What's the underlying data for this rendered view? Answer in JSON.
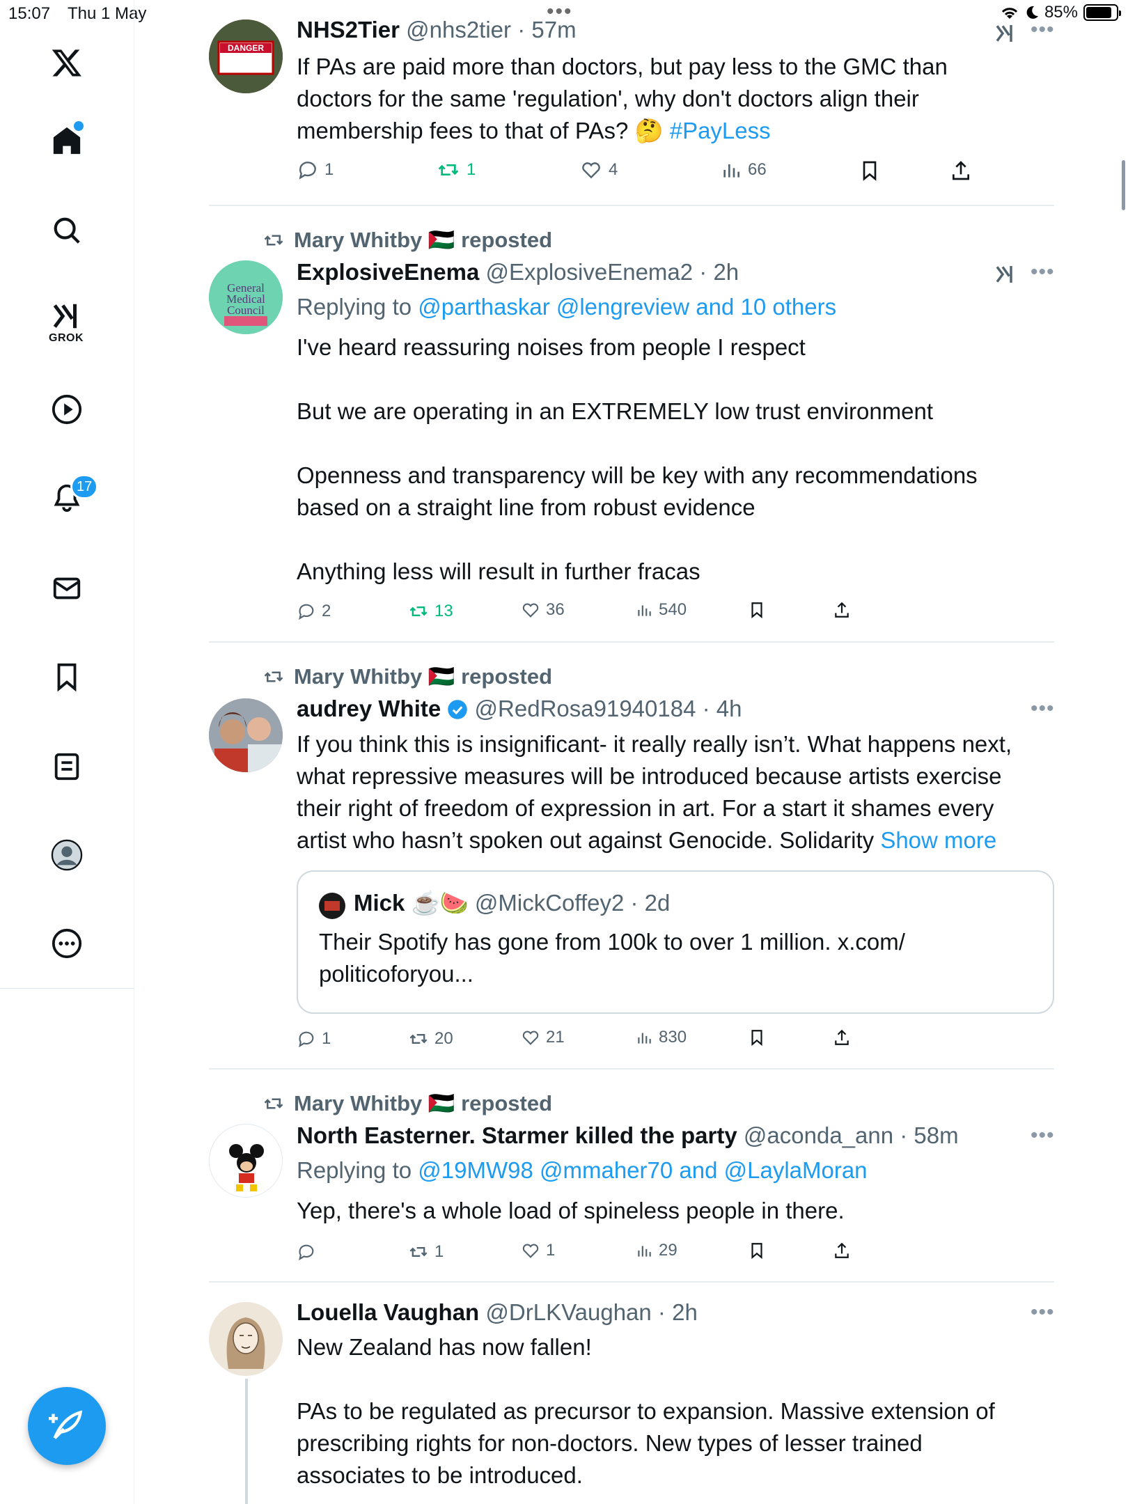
{
  "status_bar": {
    "time": "15:07",
    "date": "Thu 1 May",
    "battery": "85%",
    "battery_level": 0.85
  },
  "sidebar": {
    "grok_label": "GROK",
    "notifications_badge": "17",
    "icons": [
      "x-logo-icon",
      "home-icon",
      "search-icon",
      "grok-icon",
      "play-icon",
      "bell-icon",
      "mail-icon",
      "bookmark-icon",
      "list-icon",
      "profile-icon",
      "more-icon"
    ]
  },
  "colors": {
    "accent": "#1d9bf0",
    "repost_green": "#00ba7c",
    "muted": "#536471"
  },
  "posts": [
    {
      "name": "NHS2Tier",
      "handle": "@nhs2tier",
      "time": "57m",
      "text_1": "If PAs are paid more than doctors, but pay less to the GMC than",
      "text_2": "doctors for the same 'regulation', why don't doctors align their",
      "text_3": "membership fees to that of PAs? 🤔 ",
      "hashtag": "#PayLess",
      "replies": "1",
      "reposts": "1",
      "likes": "4",
      "views": "66"
    },
    {
      "repost_by": "Mary Whitby 🇵🇸 reposted",
      "name": "ExplosiveEnema",
      "handle": "@ExplosiveEnema2",
      "time": "2h",
      "replying_label": "Replying to ",
      "replying_to": "@parthaskar @lengreview and 10 others",
      "para_1": "I've heard reassuring noises from people I respect",
      "para_2": "But we are operating in an EXTREMELY low trust environment",
      "para_3a": "Openness and transparency will be key with any recommendations",
      "para_3b": "based on a straight line from robust evidence",
      "para_4": "Anything less will result in further fracas",
      "replies": "2",
      "reposts": "13",
      "likes": "36",
      "views": "540"
    },
    {
      "repost_by": "Mary Whitby 🇵🇸 reposted",
      "name": "audrey White",
      "handle": "@RedRosa91940184",
      "time": "4h",
      "line_1": "If you think this is insignificant- it really really isn’t. What happens next,",
      "line_2": "what repressive measures will be introduced because artists exercise",
      "line_3": "their right of freedom of expression in art. For a start it shames every",
      "line_4": "artist who hasn’t spoken out against Genocide. Solidarity ",
      "show_more": "Show more",
      "quote": {
        "name": "Mick ☕️🍉",
        "handle": "@MickCoffey2",
        "time": "2d",
        "line_1": "Their Spotify has gone from 100k to over 1 million. x.com/",
        "line_2": "politicoforyou..."
      },
      "replies": "1",
      "reposts": "20",
      "likes": "21",
      "views": "830"
    },
    {
      "repost_by": "Mary Whitby 🇵🇸 reposted",
      "name": "North Easterner. Starmer killed the party",
      "handle": "@aconda_ann",
      "time": "58m",
      "replying_label": "Replying to ",
      "replying_to": "@19MW98 @mmaher70 and @LaylaMoran",
      "text": "Yep, there's a whole load of spineless people in there.",
      "replies": "",
      "reposts": "1",
      "likes": "1",
      "views": "29"
    },
    {
      "name": "Louella Vaughan",
      "handle": "@DrLKVaughan",
      "time": "2h",
      "para_1": "New Zealand has now fallen!",
      "line_2": "PAs to be regulated as precursor to expansion. Massive extension of",
      "line_3": "prescribing rights for non-doctors. New types of lesser trained",
      "line_4": "associates to be introduced."
    }
  ]
}
